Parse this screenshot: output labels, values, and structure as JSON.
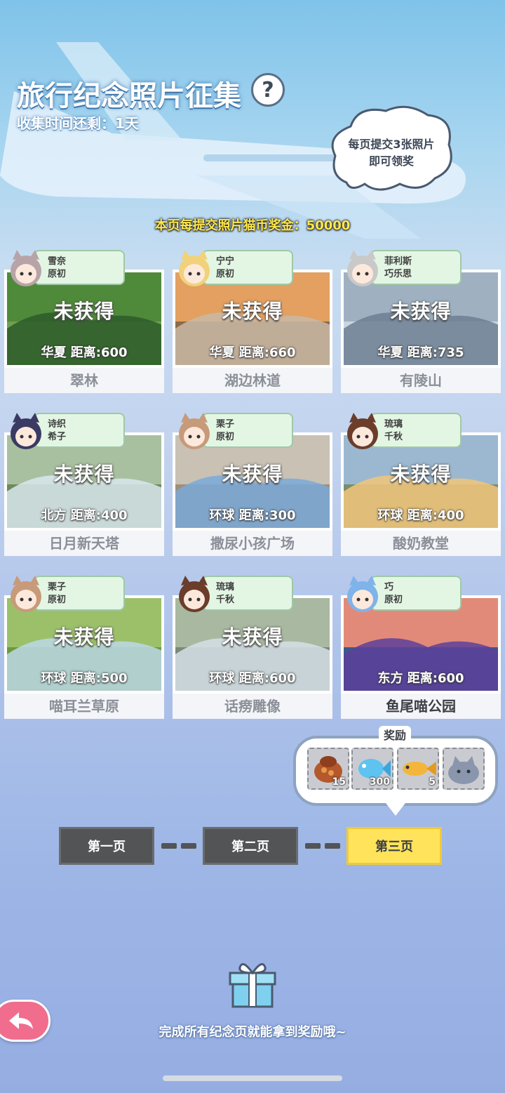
{
  "header": {
    "title": "旅行纪念照片征集",
    "help_symbol": "?",
    "timer_text": "收集时间还剩：1天",
    "bubble_line1": "每页提交3张照片",
    "bubble_line2": "即可领奖",
    "bonus_text": "本页每提交照片猫币奖金：50000"
  },
  "cards": [
    {
      "name1": "雪奈",
      "name2": "原初",
      "status": "未获得",
      "region": "华夏",
      "distance_label": "距离:600",
      "place": "翠林"
    },
    {
      "name1": "宁宁",
      "name2": "原初",
      "status": "未获得",
      "region": "华夏",
      "distance_label": "距离:660",
      "place": "湖边林道"
    },
    {
      "name1": "菲利斯",
      "name2": "巧乐思",
      "status": "未获得",
      "region": "华夏",
      "distance_label": "距离:735",
      "place": "有陵山"
    },
    {
      "name1": "诗织",
      "name2": "希子",
      "status": "未获得",
      "region": "北方",
      "distance_label": "距离:400",
      "place": "日月新天塔"
    },
    {
      "name1": "栗子",
      "name2": "原初",
      "status": "未获得",
      "region": "环球",
      "distance_label": "距离:300",
      "place": "撒尿小孩广场"
    },
    {
      "name1": "琉璃",
      "name2": "千秋",
      "status": "未获得",
      "region": "环球",
      "distance_label": "距离:400",
      "place": "酸奶教堂"
    },
    {
      "name1": "栗子",
      "name2": "原初",
      "status": "未获得",
      "region": "环球",
      "distance_label": "距离:500",
      "place": "喵耳兰草原"
    },
    {
      "name1": "琉璃",
      "name2": "千秋",
      "status": "未获得",
      "region": "环球",
      "distance_label": "距离:600",
      "place": "话痨雕像"
    },
    {
      "name1": "巧",
      "name2": "原初",
      "status": "",
      "region": "东方",
      "distance_label": "距离:600",
      "place": "鱼尾喵公园"
    }
  ],
  "reward": {
    "title": "奖励",
    "items": [
      {
        "icon": "food-bag-icon",
        "count": "15"
      },
      {
        "icon": "blue-fish-icon",
        "count": "300"
      },
      {
        "icon": "golden-fish-icon",
        "count": "5"
      },
      {
        "icon": "gray-cat-plush-icon",
        "count": ""
      }
    ]
  },
  "pages": {
    "page1": "第一页",
    "page2": "第二页",
    "page3": "第三页"
  },
  "footer": {
    "text": "完成所有纪念页就能拿到奖励哦~"
  },
  "colors": {
    "current_page": "#ffe35a",
    "page_button": "#525456",
    "tag_bg": "#e3f6e4",
    "back_button": "#f06d8d"
  }
}
